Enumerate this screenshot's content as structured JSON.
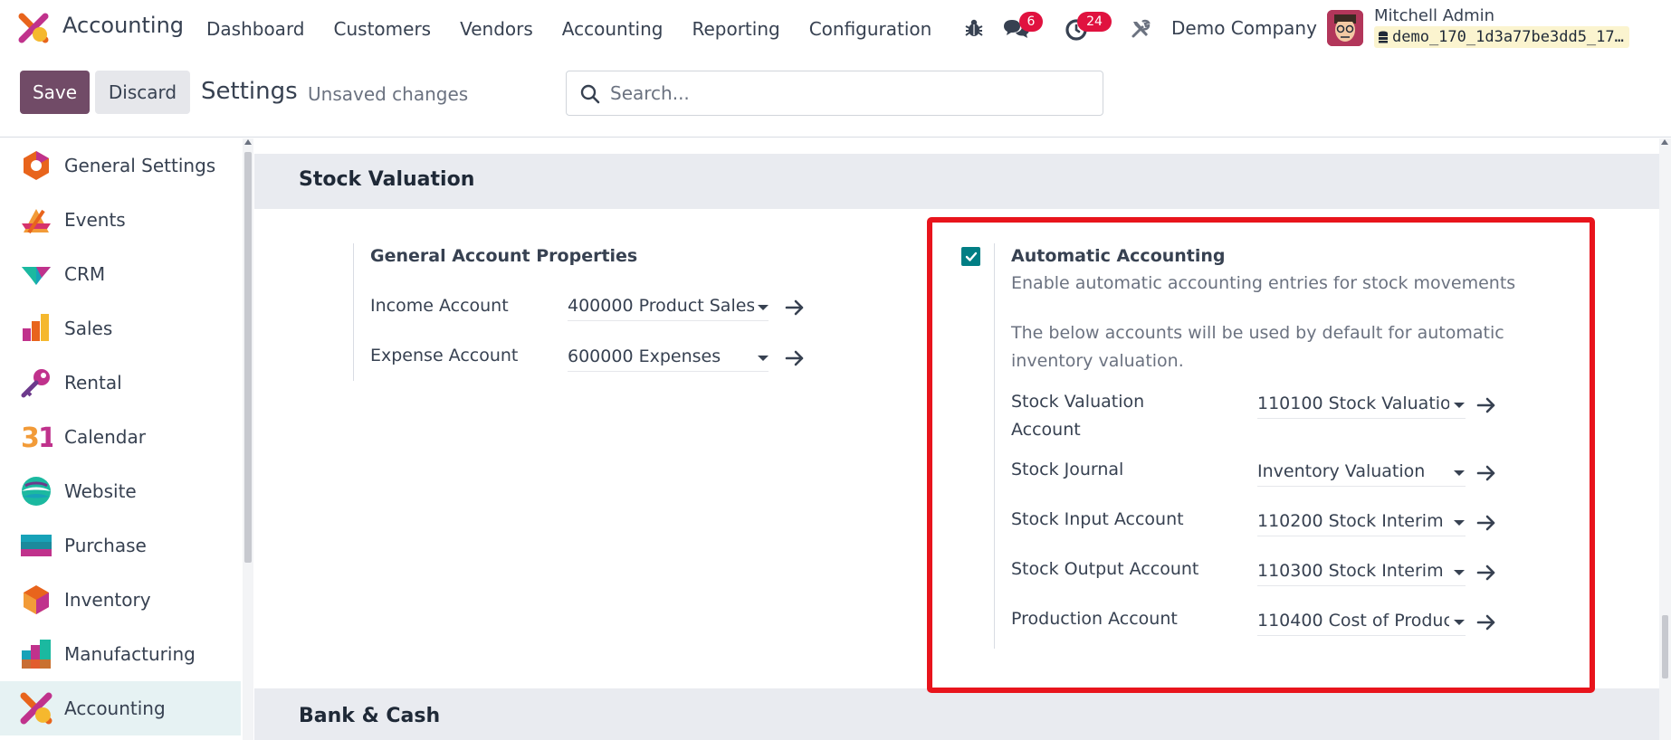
{
  "app": {
    "name": "Accounting"
  },
  "navbar": {
    "menu": [
      "Dashboard",
      "Customers",
      "Vendors",
      "Accounting",
      "Reporting",
      "Configuration"
    ],
    "messages_count": "6",
    "activities_count": "24",
    "company": "Demo Company",
    "user_name": "Mitchell Admin",
    "database": "demo_170_1d3a77be3dd5_17…"
  },
  "control": {
    "save_label": "Save",
    "discard_label": "Discard",
    "title": "Settings",
    "status": "Unsaved changes",
    "search_placeholder": "Search..."
  },
  "sidebar": {
    "items": [
      {
        "label": "General Settings",
        "icon": "general-settings-icon"
      },
      {
        "label": "Events",
        "icon": "events-icon"
      },
      {
        "label": "CRM",
        "icon": "crm-icon"
      },
      {
        "label": "Sales",
        "icon": "sales-icon"
      },
      {
        "label": "Rental",
        "icon": "rental-icon"
      },
      {
        "label": "Calendar",
        "icon": "calendar-icon"
      },
      {
        "label": "Website",
        "icon": "website-icon"
      },
      {
        "label": "Purchase",
        "icon": "purchase-icon"
      },
      {
        "label": "Inventory",
        "icon": "inventory-icon"
      },
      {
        "label": "Manufacturing",
        "icon": "manufacturing-icon"
      },
      {
        "label": "Accounting",
        "icon": "accounting-icon",
        "active": true
      }
    ]
  },
  "sections": {
    "stock_valuation": {
      "title": "Stock Valuation",
      "general": {
        "heading": "General Account Properties",
        "income_label": "Income Account",
        "income_value": "400000 Product Sales",
        "expense_label": "Expense Account",
        "expense_value": "600000 Expenses"
      },
      "automatic": {
        "checked": true,
        "heading": "Automatic Accounting",
        "description": "Enable automatic accounting entries for stock movements",
        "note_line1": "The below accounts will be used by default for automatic",
        "note_line2": "inventory valuation.",
        "fields": [
          {
            "label_line1": "Stock Valuation",
            "label_line2": "Account",
            "value": "110100 Stock Valuatio"
          },
          {
            "label_line1": "Stock Journal",
            "label_line2": "",
            "value": "Inventory Valuation"
          },
          {
            "label_line1": "Stock Input Account",
            "label_line2": "",
            "value": "110200 Stock Interim ("
          },
          {
            "label_line1": "Stock Output Account",
            "label_line2": "",
            "value": "110300 Stock Interim ("
          },
          {
            "label_line1": "Production Account",
            "label_line2": "",
            "value": "110400 Cost of Produc"
          }
        ]
      }
    },
    "bank_cash": {
      "title": "Bank & Cash"
    }
  },
  "colors": {
    "brand": "#714b67",
    "accent": "#017e84",
    "badge": "#e0123f",
    "highlight": "#e8141c"
  }
}
